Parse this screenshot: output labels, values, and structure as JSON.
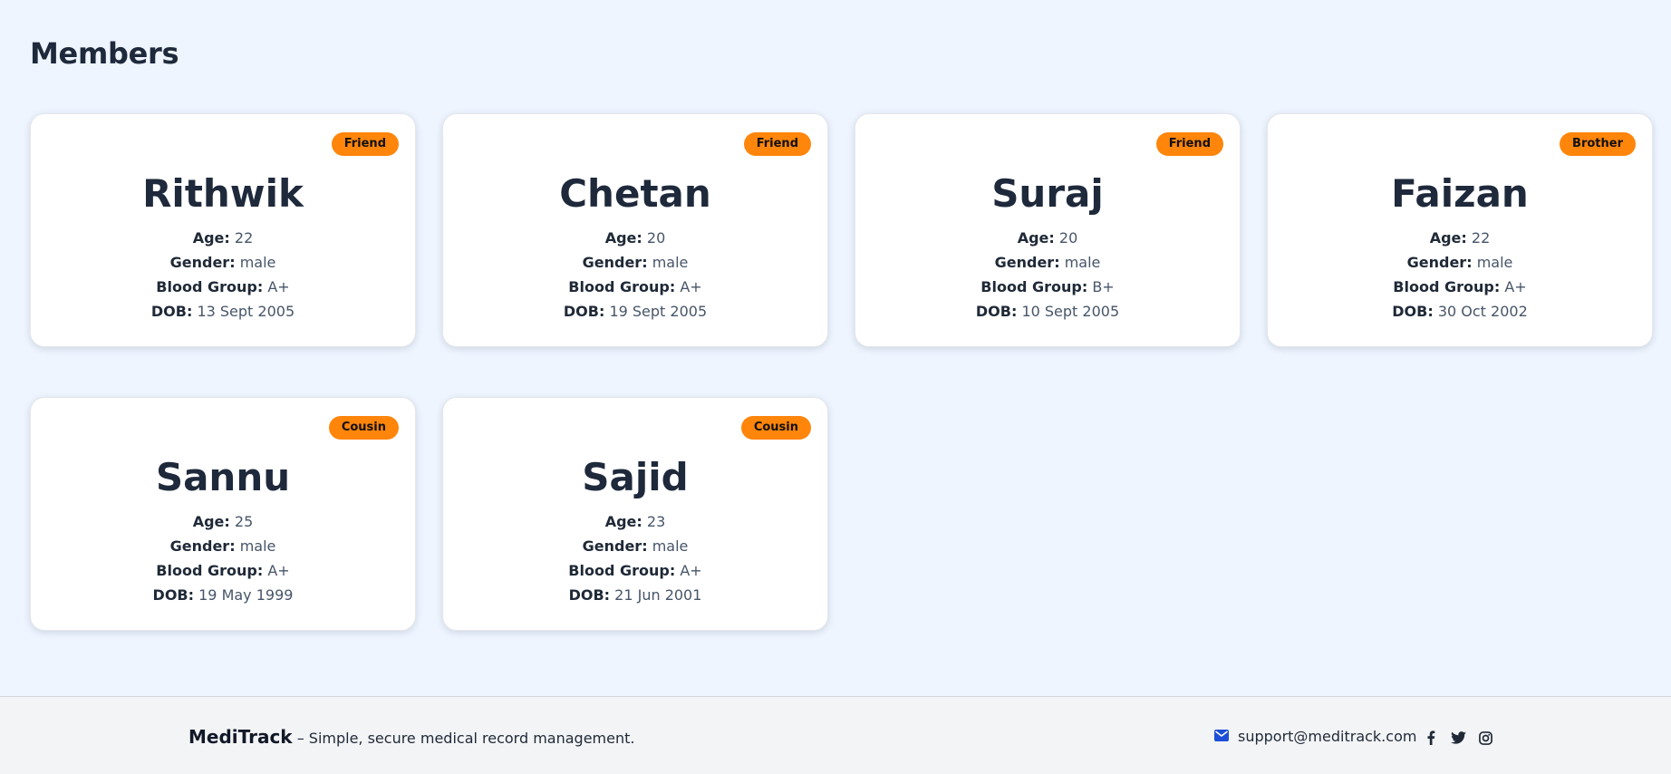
{
  "page": {
    "title": "Members"
  },
  "labels": {
    "age": "Age:",
    "gender": "Gender:",
    "blood_group": "Blood Group:",
    "dob": "DOB:"
  },
  "members": [
    {
      "name": "Rithwik",
      "relation": "Friend",
      "age": "22",
      "gender": "male",
      "blood_group": "A+",
      "dob": "13 Sept 2005"
    },
    {
      "name": "Chetan",
      "relation": "Friend",
      "age": "20",
      "gender": "male",
      "blood_group": "A+",
      "dob": "19 Sept 2005"
    },
    {
      "name": "Suraj",
      "relation": "Friend",
      "age": "20",
      "gender": "male",
      "blood_group": "B+",
      "dob": "10 Sept 2005"
    },
    {
      "name": "Faizan",
      "relation": "Brother",
      "age": "22",
      "gender": "male",
      "blood_group": "A+",
      "dob": "30 Oct 2002"
    },
    {
      "name": "Sannu",
      "relation": "Cousin",
      "age": "25",
      "gender": "male",
      "blood_group": "A+",
      "dob": "19 May 1999"
    },
    {
      "name": "Sajid",
      "relation": "Cousin",
      "age": "23",
      "gender": "male",
      "blood_group": "A+",
      "dob": "21 Jun 2001"
    }
  ],
  "footer": {
    "brand": "MediTrack",
    "tagline": " – Simple, secure medical record management.",
    "email": "support@meditrack.com",
    "social_icons": [
      "facebook-icon",
      "twitter-icon",
      "instagram-icon"
    ]
  },
  "colors": {
    "background": "#eef5ff",
    "badge": "#ff850b",
    "card": "#ffffff",
    "footer": "#f3f4f6",
    "mail_icon": "#1d4ed8"
  }
}
